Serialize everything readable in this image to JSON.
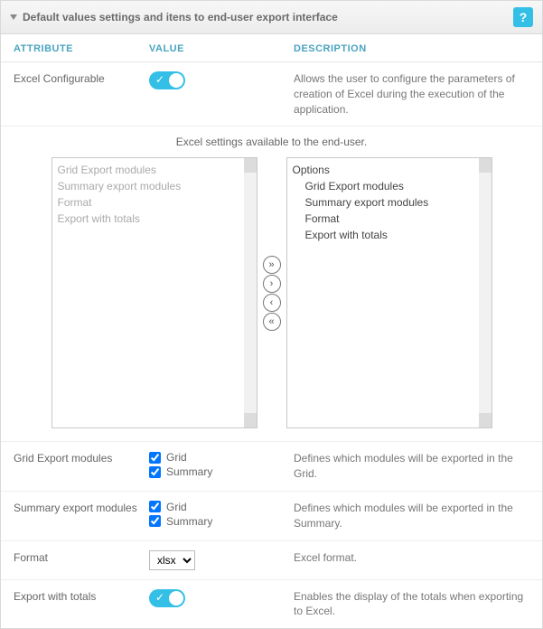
{
  "panel": {
    "title": "Default values settings and itens to end-user export interface"
  },
  "columns": {
    "attribute": "ATTRIBUTE",
    "value": "VALUE",
    "description": "DESCRIPTION"
  },
  "rows": {
    "excelConfigurable": {
      "attr": "Excel Configurable",
      "desc": "Allows the user to configure the parameters of creation of Excel during the execution of the application.",
      "on": true
    },
    "gridExport": {
      "attr": "Grid Export modules",
      "opt1": "Grid",
      "opt2": "Summary",
      "desc": "Defines which modules will be exported in the Grid."
    },
    "summaryExport": {
      "attr": "Summary export modules",
      "opt1": "Grid",
      "opt2": "Summary",
      "desc": "Defines which modules will be exported in the Summary."
    },
    "format": {
      "attr": "Format",
      "value": "xlsx",
      "desc": "Excel format."
    },
    "exportTotals": {
      "attr": "Export with totals",
      "desc": "Enables the display of the totals when exporting to Excel.",
      "on": true
    }
  },
  "dual": {
    "caption": "Excel settings available to the end-user.",
    "left": {
      "items": [
        "Grid Export modules",
        "Summary export modules",
        "Format",
        "Export with totals"
      ]
    },
    "right": {
      "header": "Options",
      "items": [
        "Grid Export modules",
        "Summary export modules",
        "Format",
        "Export with totals"
      ]
    }
  },
  "help": {
    "label": "?"
  }
}
